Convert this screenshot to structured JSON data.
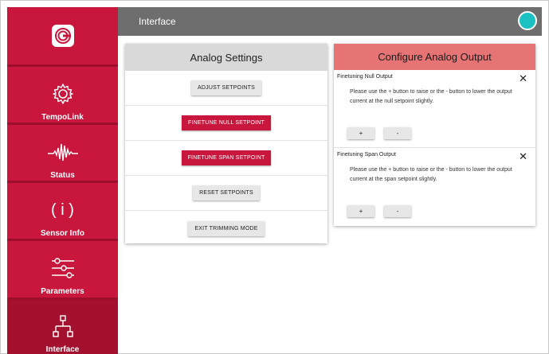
{
  "header": {
    "title": "Interface"
  },
  "sidebar": {
    "items": [
      {
        "label": "TempoLink",
        "icon": "gear-icon"
      },
      {
        "label": "Status",
        "icon": "waveform-icon"
      },
      {
        "label": "Sensor Info",
        "icon": "info-icon",
        "glyph": "( i )"
      },
      {
        "label": "Parameters",
        "icon": "sliders-icon"
      },
      {
        "label": "Interface",
        "icon": "network-icon",
        "active": true
      }
    ]
  },
  "analog_settings": {
    "title": "Analog Settings",
    "buttons": [
      "ADJUST SETPOINTS",
      "FINETUNE NULL SETPOINT",
      "FINETUNE SPAN SETPOINT",
      "RESET SETPOINTS",
      "EXIT TRIMMING MODE"
    ]
  },
  "configure_output": {
    "title": "Configure Analog Output",
    "sections": [
      {
        "title": "Finetuning Null Output",
        "description": "Please use the + button to raise or the - button to lower the output current at the null setpoint slightly.",
        "plus": "+",
        "minus": "-",
        "close": "✕"
      },
      {
        "title": "Finetuning Span Output",
        "description": "Please use the + button to raise or the - button to lower the output current at the span setpoint slightly.",
        "plus": "+",
        "minus": "-",
        "close": "✕"
      }
    ]
  },
  "colors": {
    "brand_red": "#c8163d",
    "header_grey": "#6e6e6e",
    "status_teal": "#1cc1c1",
    "config_header": "#e77475"
  }
}
